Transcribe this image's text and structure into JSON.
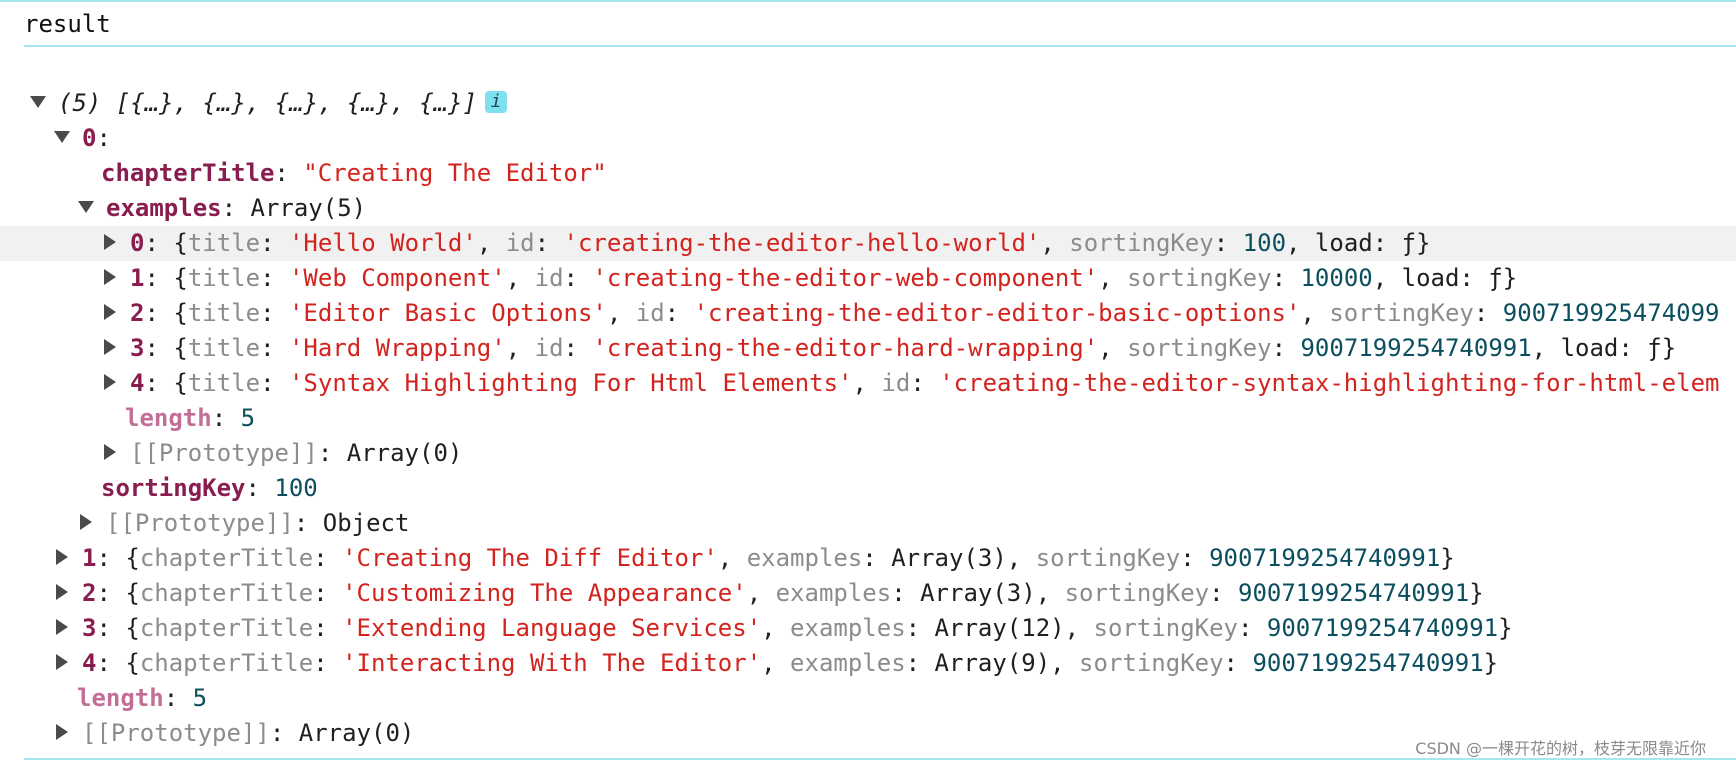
{
  "header": {
    "title": "result"
  },
  "root": {
    "preview": "(5) [{…}, {…}, {…}, {…}, {…}]",
    "info_icon": "i"
  },
  "item0": {
    "index": "0",
    "chapterTitle_key": "chapterTitle",
    "chapterTitle_value": "\"Creating The Editor\"",
    "examples_key": "examples",
    "examples_value": "Array(5)",
    "examples": [
      {
        "index": "0",
        "title": "'Hello World'",
        "id": "'creating-the-editor-hello-world'",
        "sortingKey": "100",
        "tail": ", load: ƒ}"
      },
      {
        "index": "1",
        "title": "'Web Component'",
        "id": "'creating-the-editor-web-component'",
        "sortingKey": "10000",
        "tail": ", load: ƒ}"
      },
      {
        "index": "2",
        "title": "'Editor Basic Options'",
        "id": "'creating-the-editor-editor-basic-options'",
        "sortingKey": "900719925474099",
        "tail": ""
      },
      {
        "index": "3",
        "title": "'Hard Wrapping'",
        "id": "'creating-the-editor-hard-wrapping'",
        "sortingKey": "9007199254740991",
        "tail": ", load: ƒ}"
      },
      {
        "index": "4",
        "title": "'Syntax Highlighting For Html Elements'",
        "id": "'creating-the-editor-syntax-highlighting-for-html-elem",
        "sortingKey": "",
        "tail": ""
      }
    ],
    "examples_length_key": "length",
    "examples_length_value": "5",
    "examples_proto_key": "[[Prototype]]",
    "examples_proto_value": "Array(0)",
    "sortingKey_key": "sortingKey",
    "sortingKey_value": "100",
    "proto_key": "[[Prototype]]",
    "proto_value": "Object"
  },
  "collapsed_items": [
    {
      "index": "1",
      "chapterTitle": "'Creating The Diff Editor'",
      "examples": "Array(3)",
      "sortingKey": "9007199254740991"
    },
    {
      "index": "2",
      "chapterTitle": "'Customizing The Appearance'",
      "examples": "Array(3)",
      "sortingKey": "9007199254740991"
    },
    {
      "index": "3",
      "chapterTitle": "'Extending Language Services'",
      "examples": "Array(12)",
      "sortingKey": "9007199254740991"
    },
    {
      "index": "4",
      "chapterTitle": "'Interacting With The Editor'",
      "examples": "Array(9)",
      "sortingKey": "9007199254740991"
    }
  ],
  "root_length_key": "length",
  "root_length_value": "5",
  "root_proto_key": "[[Prototype]]",
  "root_proto_value": "Array(0)",
  "watermark": "CSDN @一棵开花的树，枝芽无限靠近你",
  "colors": {
    "key": "#8a1d4f",
    "string": "#d3231e",
    "number": "#0b4f5f",
    "dim_key": "#8c8c8c",
    "rule": "#a8e6ee",
    "badge": "#7fe0f0"
  },
  "icons": {
    "expanded": "triangle-down-icon",
    "collapsed": "triangle-right-icon",
    "info": "info-icon"
  }
}
